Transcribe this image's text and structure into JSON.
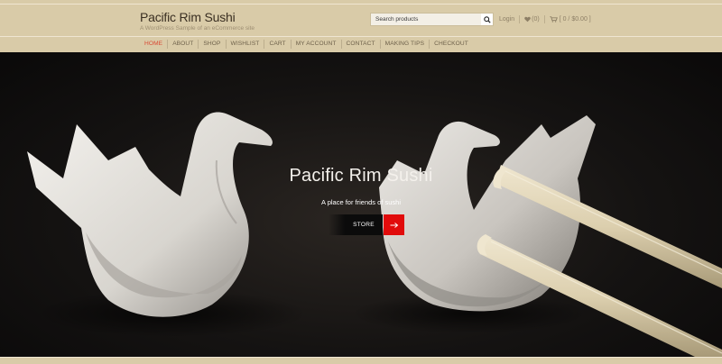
{
  "header": {
    "site_title": "Pacific Rim Sushi",
    "site_tagline": "A WordPress Sample of an eCommerce site",
    "search": {
      "placeholder": "Search products"
    },
    "login_label": "Login",
    "wishlist_count": "(0)",
    "cart_summary": "[ 0 / $0.00 ]"
  },
  "nav": {
    "items": [
      {
        "label": "HOME",
        "active": true
      },
      {
        "label": "ABOUT"
      },
      {
        "label": "SHOP"
      },
      {
        "label": "WISHLIST"
      },
      {
        "label": "CART"
      },
      {
        "label": "MY ACCOUNT"
      },
      {
        "label": "CONTACT"
      },
      {
        "label": "MAKING TIPS"
      },
      {
        "label": "CHECKOUT"
      }
    ]
  },
  "hero": {
    "title": "Pacific Rim Sushi",
    "subtitle": "A place for friends of sushi",
    "store_label": "STORE"
  },
  "icons": {
    "search": "search-icon",
    "wishlist": "heart-icon",
    "cart": "cart-icon",
    "go": "arrow-right-icon"
  },
  "colors": {
    "header_bg": "#d9cba8",
    "nav_active": "#d94a35",
    "go_button": "#e10b0b"
  }
}
